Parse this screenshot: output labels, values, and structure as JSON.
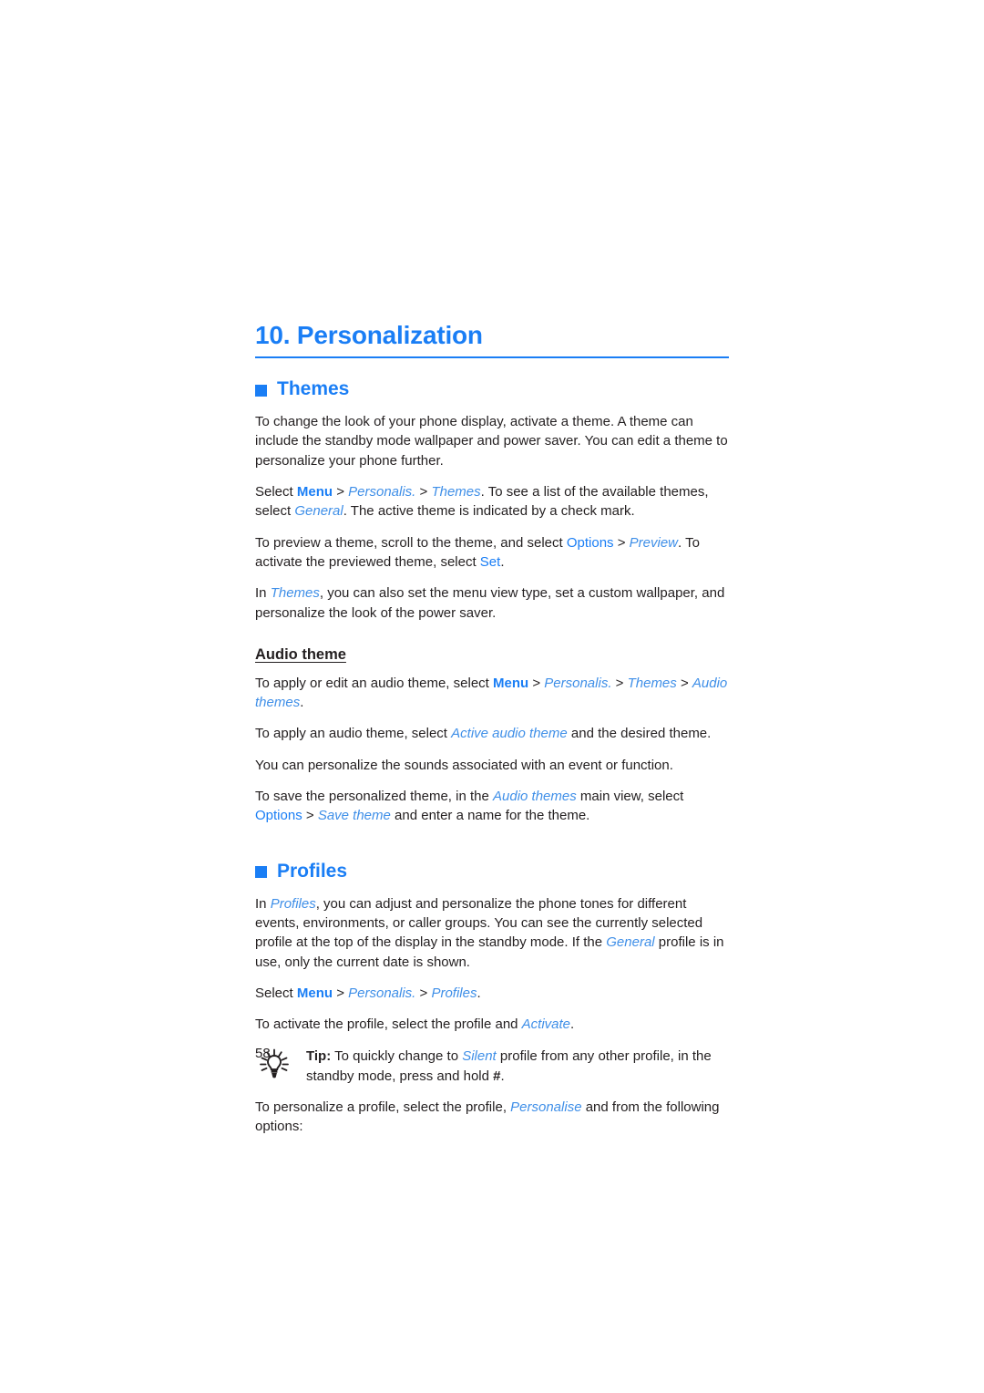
{
  "colors": {
    "accent_blue": "#1a7ef5",
    "italic_blue": "#3f8fe8",
    "body_text": "#231f20",
    "page_background": "#ffffff"
  },
  "chapter": {
    "title": "10. Personalization"
  },
  "sections": [
    {
      "id": "themes",
      "bullet_icon": "square-bullet-icon",
      "heading": "Themes",
      "paragraphs": [
        {
          "id": "themes-intro",
          "runs": [
            {
              "text": "To change the look of your phone display, activate a theme. A theme can include the standby mode wallpaper and power saver. You can edit a theme to personalize your phone further.",
              "style": "plain"
            }
          ]
        },
        {
          "id": "themes-select-path",
          "runs": [
            {
              "text": "Select ",
              "style": "plain"
            },
            {
              "text": "Menu",
              "style": "ui-bold"
            },
            {
              "text": " > ",
              "style": "plain"
            },
            {
              "text": "Personalis.",
              "style": "ui-italic"
            },
            {
              "text": " > ",
              "style": "plain"
            },
            {
              "text": "Themes",
              "style": "ui-italic"
            },
            {
              "text": ". To see a list of the available themes, select ",
              "style": "plain"
            },
            {
              "text": "General",
              "style": "ui-italic"
            },
            {
              "text": ". The active theme is indicated by a check mark.",
              "style": "plain"
            }
          ]
        },
        {
          "id": "themes-preview",
          "runs": [
            {
              "text": "To preview a theme, scroll to the theme, and select ",
              "style": "plain"
            },
            {
              "text": "Options",
              "style": "ui-plain"
            },
            {
              "text": " > ",
              "style": "plain"
            },
            {
              "text": "Preview",
              "style": "ui-italic"
            },
            {
              "text": ". To activate the previewed theme, select ",
              "style": "plain"
            },
            {
              "text": "Set",
              "style": "ui-plain"
            },
            {
              "text": ".",
              "style": "plain"
            }
          ]
        },
        {
          "id": "themes-menu-view",
          "runs": [
            {
              "text": "In ",
              "style": "plain"
            },
            {
              "text": "Themes",
              "style": "ui-italic"
            },
            {
              "text": ", you can also set the menu view type, set a custom wallpaper, and personalize the look of the power saver.",
              "style": "plain"
            }
          ]
        }
      ],
      "subsection": {
        "id": "audio-theme",
        "heading": "Audio theme",
        "paragraphs": [
          {
            "id": "audio-apply-edit",
            "runs": [
              {
                "text": "To apply or edit an audio theme, select ",
                "style": "plain"
              },
              {
                "text": "Menu",
                "style": "ui-bold"
              },
              {
                "text": " > ",
                "style": "plain"
              },
              {
                "text": "Personalis.",
                "style": "ui-italic"
              },
              {
                "text": " > ",
                "style": "plain"
              },
              {
                "text": "Themes",
                "style": "ui-italic"
              },
              {
                "text": " > ",
                "style": "plain"
              },
              {
                "text": "Audio themes",
                "style": "ui-italic"
              },
              {
                "text": ".",
                "style": "plain"
              }
            ]
          },
          {
            "id": "audio-apply",
            "runs": [
              {
                "text": "To apply an audio theme, select ",
                "style": "plain"
              },
              {
                "text": "Active audio theme",
                "style": "ui-italic"
              },
              {
                "text": " and the desired theme.",
                "style": "plain"
              }
            ]
          },
          {
            "id": "audio-personalize-sounds",
            "runs": [
              {
                "text": "You can personalize the sounds associated with an event or function.",
                "style": "plain"
              }
            ]
          },
          {
            "id": "audio-save",
            "runs": [
              {
                "text": "To save the personalized theme, in the ",
                "style": "plain"
              },
              {
                "text": "Audio themes",
                "style": "ui-italic"
              },
              {
                "text": " main view, select ",
                "style": "plain"
              },
              {
                "text": "Options",
                "style": "ui-plain"
              },
              {
                "text": " > ",
                "style": "plain"
              },
              {
                "text": "Save theme",
                "style": "ui-italic"
              },
              {
                "text": " and enter a name for the theme.",
                "style": "plain"
              }
            ]
          }
        ]
      }
    },
    {
      "id": "profiles",
      "bullet_icon": "square-bullet-icon",
      "heading": "Profiles",
      "paragraphs": [
        {
          "id": "profiles-intro",
          "runs": [
            {
              "text": "In ",
              "style": "plain"
            },
            {
              "text": "Profiles",
              "style": "ui-italic"
            },
            {
              "text": ", you can adjust and personalize the phone tones for different events, environments, or caller groups. You can see the currently selected profile at the top of the display in the standby mode. If the ",
              "style": "plain"
            },
            {
              "text": "General",
              "style": "ui-italic"
            },
            {
              "text": " profile is in use, only the current date is shown.",
              "style": "plain"
            }
          ]
        },
        {
          "id": "profiles-select-path",
          "runs": [
            {
              "text": "Select ",
              "style": "plain"
            },
            {
              "text": "Menu",
              "style": "ui-bold"
            },
            {
              "text": " > ",
              "style": "plain"
            },
            {
              "text": "Personalis.",
              "style": "ui-italic"
            },
            {
              "text": " > ",
              "style": "plain"
            },
            {
              "text": "Profiles",
              "style": "ui-italic"
            },
            {
              "text": ".",
              "style": "plain"
            }
          ]
        },
        {
          "id": "profiles-activate",
          "runs": [
            {
              "text": "To activate the profile, select the profile and ",
              "style": "plain"
            },
            {
              "text": "Activate",
              "style": "ui-italic"
            },
            {
              "text": ".",
              "style": "plain"
            }
          ]
        }
      ],
      "tip": {
        "id": "profiles-tip",
        "icon": "lightbulb-icon",
        "runs": [
          {
            "text": "Tip:",
            "style": "black-bold"
          },
          {
            "text": " To quickly change to ",
            "style": "plain"
          },
          {
            "text": "Silent",
            "style": "ui-italic"
          },
          {
            "text": " profile from any other profile, in the standby mode, press and hold ",
            "style": "plain"
          },
          {
            "text": "#",
            "style": "black-bold"
          },
          {
            "text": ".",
            "style": "plain"
          }
        ]
      },
      "closing_paragraph": {
        "id": "profiles-personalize",
        "runs": [
          {
            "text": "To personalize a profile, select the profile, ",
            "style": "plain"
          },
          {
            "text": "Personalise",
            "style": "ui-italic"
          },
          {
            "text": " and from the following options:",
            "style": "plain"
          }
        ]
      }
    }
  ],
  "footer": {
    "page_number": "58"
  }
}
